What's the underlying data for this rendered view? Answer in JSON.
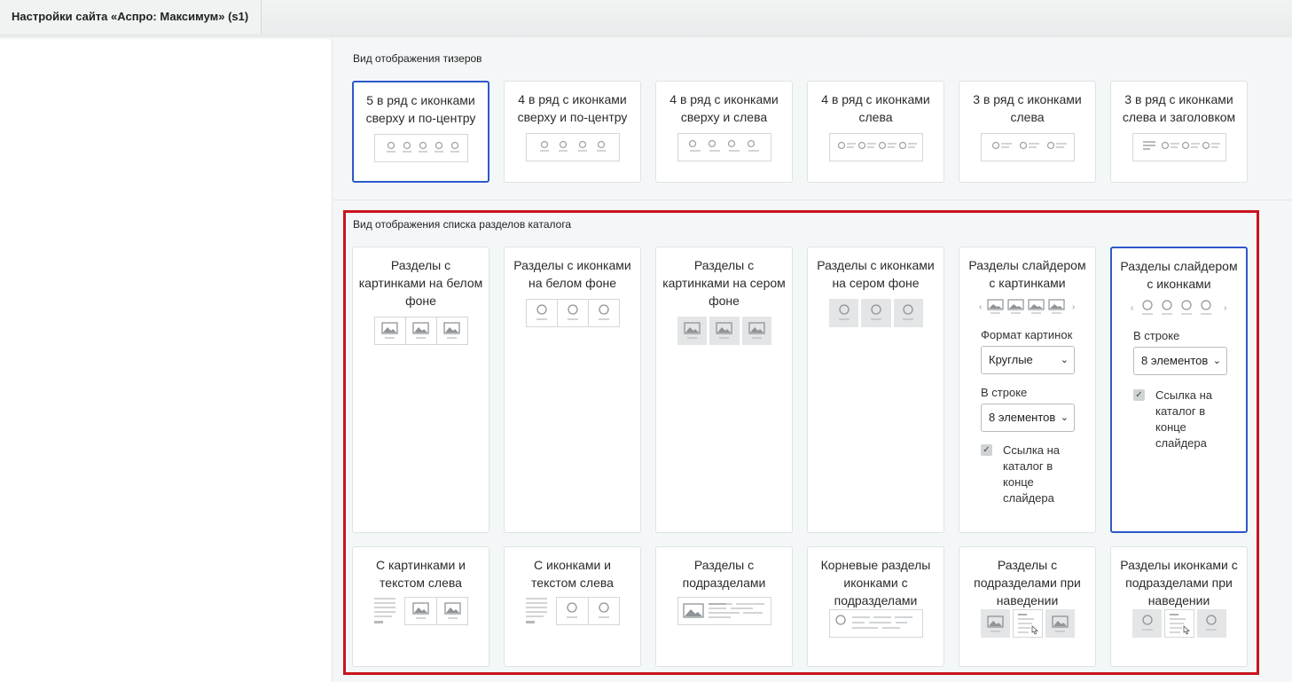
{
  "window": {
    "tab_title": "Настройки сайта «Аспро: Максимум» (s1)"
  },
  "teasers": {
    "title": "Вид отображения тизеров",
    "cards": [
      {
        "label": "5 в ряд с иконками сверху и по-центру",
        "selected": true
      },
      {
        "label": "4 в ряд с иконками сверху и по-центру",
        "selected": false
      },
      {
        "label": "4 в ряд с иконками сверху и слева",
        "selected": false
      },
      {
        "label": "4 в ряд с иконками слева",
        "selected": false
      },
      {
        "label": "3 в ряд с иконками слева",
        "selected": false
      },
      {
        "label": "3 в ряд с иконками слева и заголовком",
        "selected": false
      }
    ]
  },
  "catalog_sections": {
    "title": "Вид отображения списка разделов каталога",
    "cards": [
      {
        "label": "Разделы с картинками на белом фоне",
        "selected": false
      },
      {
        "label": "Разделы с иконками на белом фоне",
        "selected": false
      },
      {
        "label": "Разделы с картинками на сером фоне",
        "selected": false
      },
      {
        "label": "Разделы с иконками на сером фоне",
        "selected": false
      },
      {
        "label": "Разделы слайдером с картинками",
        "selected": false
      },
      {
        "label": "Разделы слайдером с иконками",
        "selected": true
      },
      {
        "label": "С картинками и текстом слева",
        "selected": false
      },
      {
        "label": "С иконками и текстом слева",
        "selected": false
      },
      {
        "label": "Разделы с подразделами",
        "selected": false
      },
      {
        "label": "Корневые разделы иконками с подразделами",
        "selected": false
      },
      {
        "label": "Разделы с подразделами при наведении",
        "selected": false
      },
      {
        "label": "Разделы иконками с подразделами при наведении",
        "selected": false
      }
    ],
    "slider_pictures_options": {
      "format_label": "Формат картинок",
      "format_value": "Круглые",
      "per_row_label": "В строке",
      "per_row_value": "8 элементов",
      "link_label": "Ссылка на каталог в конце слайдера",
      "link_checked": true
    },
    "slider_icons_options": {
      "per_row_label": "В строке",
      "per_row_value": "8 элементов",
      "link_label": "Ссылка на каталог в конце слайдера",
      "link_checked": true
    }
  },
  "colors": {
    "selected_border": "#2e59c9",
    "highlight_frame": "#c8141e",
    "panel_background": "#f4f7f8"
  }
}
